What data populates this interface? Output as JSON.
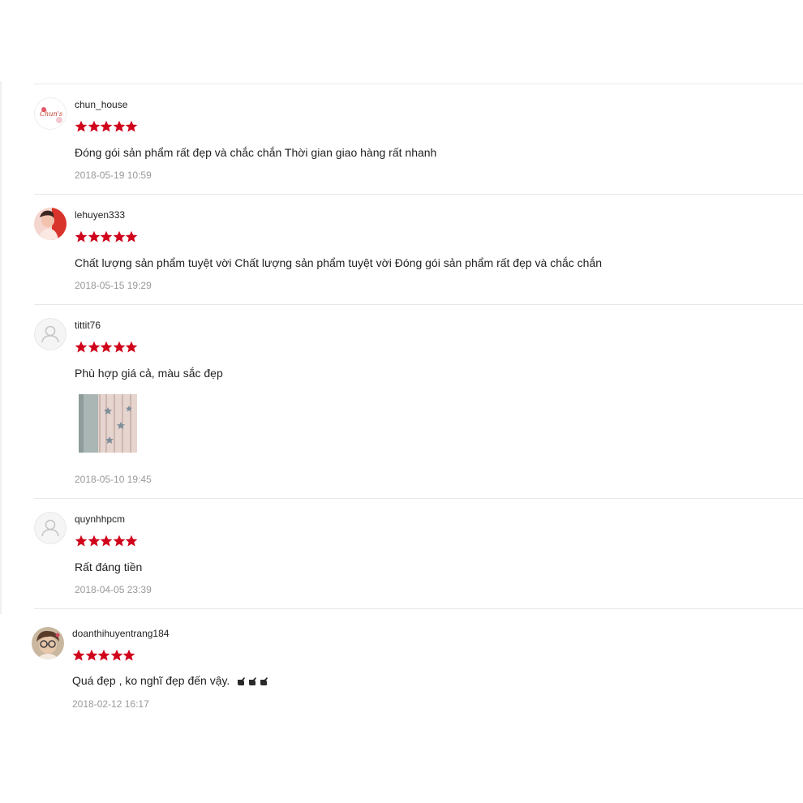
{
  "colors": {
    "star": "#d0011b",
    "divider": "#e8e8e8",
    "date": "#999999",
    "text": "#222222"
  },
  "reviews": [
    {
      "username": "chun_house",
      "rating": 5,
      "comment": " Đóng gói sản phẩm rất đẹp và chắc chắn Thời gian giao hàng rất nhanh",
      "date": "2018-05-19 10:59",
      "avatar": "shop-logo-avatar",
      "avatar_text": "Chun's"
    },
    {
      "username": "lehuyen333",
      "rating": 5,
      "comment": " Chất lượng sản phẩm tuyệt vời Chất lượng sản phẩm tuyệt vời Đóng gói sản phẩm rất đẹp và chắc chắn",
      "date": "2018-05-15 19:29",
      "avatar": "photo-avatar"
    },
    {
      "username": "tittit76",
      "rating": 5,
      "comment": "Phù hợp giá cả, màu sắc đẹp",
      "date": "2018-05-10 19:45",
      "avatar": "default-user-icon",
      "has_image": true
    },
    {
      "username": "quynhhpcm",
      "rating": 5,
      "comment": " Rất đáng tiền",
      "date": "2018-04-05 23:39",
      "avatar": "default-user-icon"
    },
    {
      "username": "doanthihuyentrang184",
      "rating": 5,
      "comment": "Quá đẹp , ko nghĩ đẹp đến vậy.",
      "comment_emoji": "pointing-hand-icon x3",
      "date": "2018-02-12 16:17",
      "avatar": "photo-avatar"
    }
  ]
}
